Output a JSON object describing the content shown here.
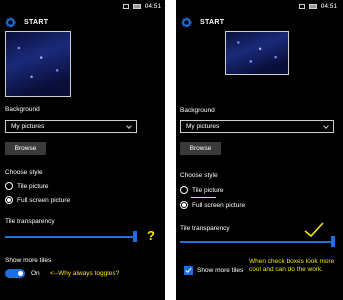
{
  "status_bar": {
    "time": "04:51"
  },
  "header": {
    "title": "START"
  },
  "background": {
    "label": "Background",
    "selected": "My pictures",
    "browse_label": "Browse"
  },
  "style": {
    "label": "Choose style",
    "options": [
      "Tile picture",
      "Full screen picture"
    ],
    "selected_index": 1
  },
  "transparency": {
    "label": "Tile transparency",
    "value_fraction": 0.97
  },
  "more_tiles": {
    "label": "Show more tiles",
    "toggle_state": "On",
    "checked": true
  },
  "annotations": {
    "left_question": "?",
    "left_note": "<--Why always toggles?",
    "right_note": "When check boxes look more cool and can do the work."
  },
  "colors": {
    "accent": "#1e6fdb",
    "annotation": "#f5e400",
    "background": "#000000"
  }
}
